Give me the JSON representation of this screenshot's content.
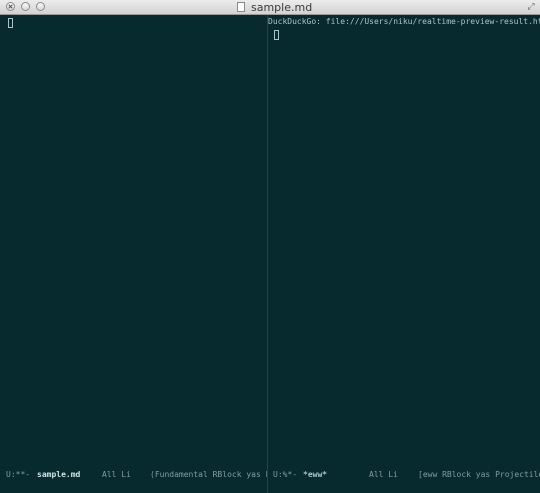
{
  "window": {
    "title": "sample.md"
  },
  "left_pane": {
    "cursor": ""
  },
  "right_pane": {
    "header": "DuckDuckGo: file:///Users/niku/realtime-preview-result.html",
    "cursor": ""
  },
  "modeline_left": {
    "status": "U:**-",
    "buffer_name": "sample.md",
    "position": "All Li",
    "modes": "(Fundamental RBlock yas Pro"
  },
  "modeline_right": {
    "status": "U:%*-",
    "buffer_name": "*eww*",
    "position": "All Li",
    "modes": "[eww RBlock yas Projectile[n"
  }
}
